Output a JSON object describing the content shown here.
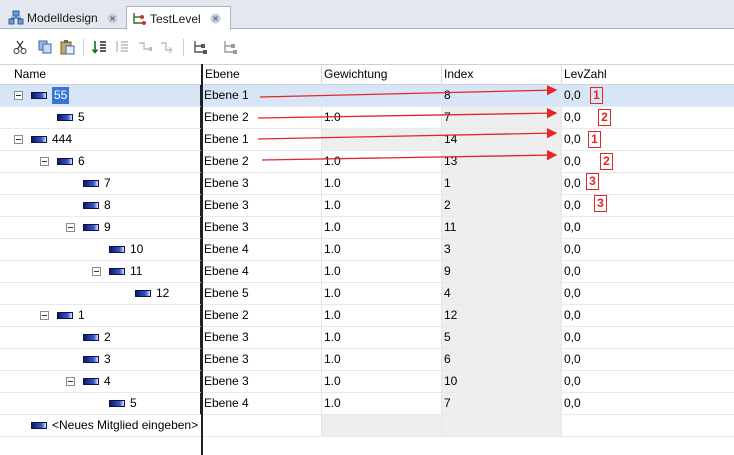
{
  "tabs": [
    {
      "label": "Modelldesign",
      "active": false
    },
    {
      "label": "TestLevel",
      "active": true
    }
  ],
  "columns": {
    "name": "Name",
    "ebene": "Ebene",
    "gewichtung": "Gewichtung",
    "index": "Index",
    "levzahl": "LevZahl"
  },
  "rows": [
    {
      "name": "55",
      "depth": 0,
      "expandable": true,
      "ebene": "Ebene 1",
      "gewichtung": "",
      "index": "8",
      "levzahl": "0,0",
      "selected": true,
      "badge": "1"
    },
    {
      "name": "5",
      "depth": 1,
      "expandable": false,
      "ebene": "Ebene 2",
      "gewichtung": "1.0",
      "index": "7",
      "levzahl": "0,0",
      "badge": "2"
    },
    {
      "name": "444",
      "depth": 0,
      "expandable": true,
      "ebene": "Ebene 1",
      "gewichtung": "",
      "index": "14",
      "levzahl": "0,0",
      "badge": "1"
    },
    {
      "name": "6",
      "depth": 1,
      "expandable": true,
      "ebene": "Ebene 2",
      "gewichtung": "1.0",
      "index": "13",
      "levzahl": "0,0",
      "badge": "2"
    },
    {
      "name": "7",
      "depth": 2,
      "expandable": false,
      "ebene": "Ebene 3",
      "gewichtung": "1.0",
      "index": "1",
      "levzahl": "0,0",
      "badge": "3"
    },
    {
      "name": "8",
      "depth": 2,
      "expandable": false,
      "ebene": "Ebene 3",
      "gewichtung": "1.0",
      "index": "2",
      "levzahl": "0,0",
      "badge": "3"
    },
    {
      "name": "9",
      "depth": 2,
      "expandable": true,
      "ebene": "Ebene 3",
      "gewichtung": "1.0",
      "index": "11",
      "levzahl": "0,0"
    },
    {
      "name": "10",
      "depth": 3,
      "expandable": false,
      "ebene": "Ebene 4",
      "gewichtung": "1.0",
      "index": "3",
      "levzahl": "0,0"
    },
    {
      "name": "11",
      "depth": 3,
      "expandable": true,
      "ebene": "Ebene 4",
      "gewichtung": "1.0",
      "index": "9",
      "levzahl": "0,0"
    },
    {
      "name": "12",
      "depth": 4,
      "expandable": false,
      "ebene": "Ebene 5",
      "gewichtung": "1.0",
      "index": "4",
      "levzahl": "0,0"
    },
    {
      "name": "1",
      "depth": 1,
      "expandable": true,
      "ebene": "Ebene 2",
      "gewichtung": "1.0",
      "index": "12",
      "levzahl": "0,0"
    },
    {
      "name": "2",
      "depth": 2,
      "expandable": false,
      "ebene": "Ebene 3",
      "gewichtung": "1.0",
      "index": "5",
      "levzahl": "0,0"
    },
    {
      "name": "3",
      "depth": 2,
      "expandable": false,
      "ebene": "Ebene 3",
      "gewichtung": "1.0",
      "index": "6",
      "levzahl": "0,0"
    },
    {
      "name": "4",
      "depth": 2,
      "expandable": true,
      "ebene": "Ebene 3",
      "gewichtung": "1.0",
      "index": "10",
      "levzahl": "0,0"
    },
    {
      "name": "5",
      "depth": 3,
      "expandable": false,
      "ebene": "Ebene 4",
      "gewichtung": "1.0",
      "index": "7",
      "levzahl": "0,0"
    }
  ],
  "new_member": "<Neues Mitglied eingeben>",
  "toolbar_icons": [
    "cut-icon",
    "copy-icon",
    "paste-icon",
    "sort-icon",
    "indent-icon",
    "outdent-icon",
    "move-icon",
    "hierarchy-icon",
    "hierarchy-add-icon"
  ],
  "colors": {
    "selection": "#d6e6f7",
    "annotation": "#e32626",
    "tabbar": "#e4e8ee"
  }
}
